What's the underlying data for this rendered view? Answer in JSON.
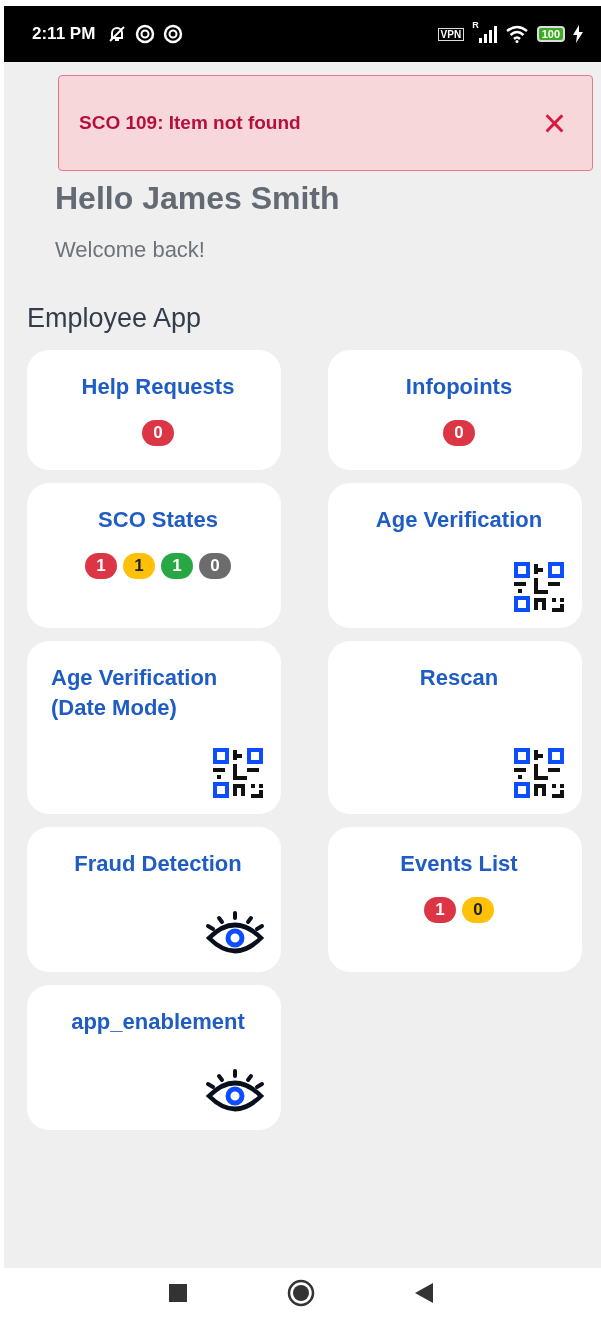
{
  "status_bar": {
    "time": "2:11 PM",
    "vpn": "VPN",
    "roaming": "R",
    "battery": "100"
  },
  "toast": {
    "message": "SCO 109: Item not found",
    "close": "×"
  },
  "greeting": {
    "title": "Hello James Smith",
    "subtitle": "Welcome back!"
  },
  "section_title": "Employee App",
  "tiles": [
    {
      "title": "Help Requests",
      "kind": "badges",
      "badges": [
        {
          "count": "0",
          "color": "#dc3545"
        }
      ]
    },
    {
      "title": "Infopoints",
      "kind": "badges",
      "badges": [
        {
          "count": "0",
          "color": "#dc3545"
        }
      ]
    },
    {
      "title": "SCO States",
      "kind": "badges",
      "badges": [
        {
          "count": "1",
          "color": "#dc3545"
        },
        {
          "count": "1",
          "color": "#ffc107"
        },
        {
          "count": "1",
          "color": "#28a745"
        },
        {
          "count": "0",
          "color": "#6c6c6c"
        }
      ]
    },
    {
      "title": "Age Verification",
      "kind": "qr"
    },
    {
      "title": "Age Verification (Date Mode)",
      "kind": "qr"
    },
    {
      "title": "Rescan",
      "kind": "qr"
    },
    {
      "title": "Fraud Detection",
      "kind": "eye"
    },
    {
      "title": "Events List",
      "kind": "badges",
      "badges": [
        {
          "count": "1",
          "color": "#dc3545"
        },
        {
          "count": "0",
          "color": "#ffc107"
        }
      ]
    },
    {
      "title": "app_enablement",
      "kind": "eye"
    }
  ]
}
